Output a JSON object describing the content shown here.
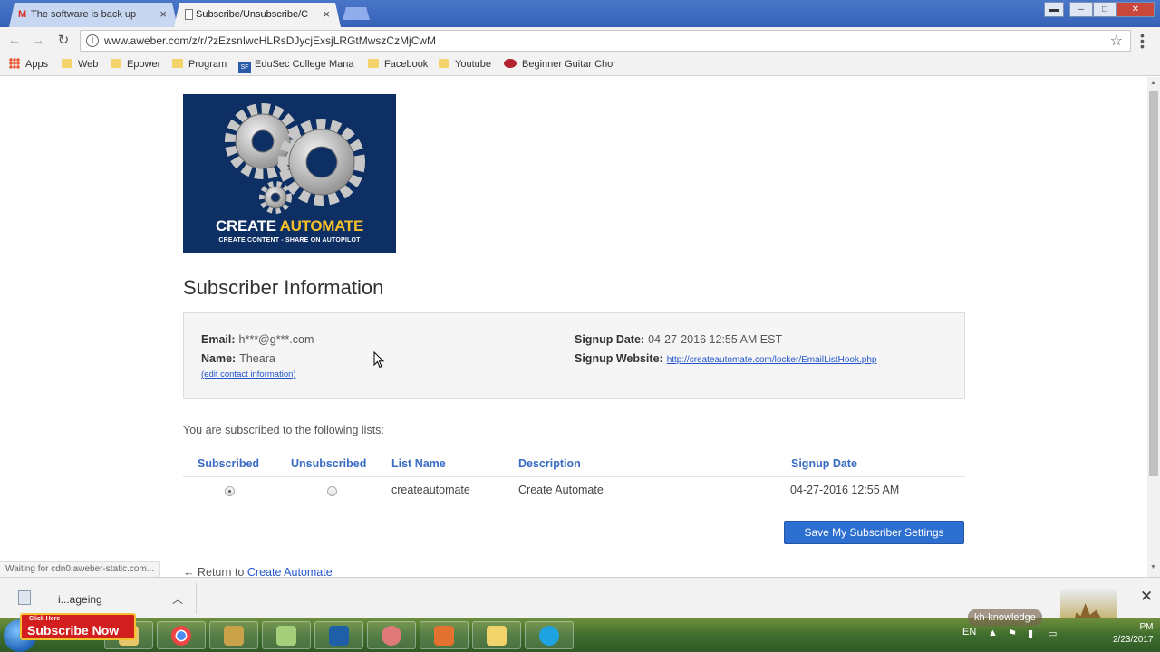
{
  "browser": {
    "tabs": [
      {
        "label": "The software is back up",
        "active": false,
        "favicon": "gmail-icon"
      },
      {
        "label": "Subscribe/Unsubscribe/C",
        "active": true,
        "favicon": "page-icon"
      }
    ],
    "url": "www.aweber.com/z/r/?zEzsnIwcHLRsDJycjExsjLRGtMwszCzMjCwM",
    "bookmarks": [
      "Apps",
      "Web",
      "Epower",
      "Program",
      "EduSec College Mana",
      "Facebook",
      "Youtube",
      "Beginner Guitar Chor"
    ],
    "status_text": "Waiting for cdn0.aweber-static.com..."
  },
  "page": {
    "logo": {
      "brand_left": "CREATE ",
      "brand_right": "AUTOMATE",
      "tagline": "CREATE CONTENT - SHARE ON AUTOPILOT"
    },
    "title": "Subscriber Information",
    "info": {
      "email_label": "Email:",
      "email": "h***@g***.com",
      "name_label": "Name:",
      "name": "Theara",
      "edit_link": "(edit contact information)",
      "signup_date_label": "Signup Date:",
      "signup_date": "04-27-2016 12:55 AM EST",
      "signup_website_label": "Signup Website:",
      "signup_website": "http://createautomate.com/locker/EmailListHook.php"
    },
    "lists_intro": "You are subscribed to the following lists:",
    "table": {
      "headers": [
        "Subscribed",
        "Unsubscribed",
        "List Name",
        "Description",
        "Signup Date"
      ],
      "rows": [
        {
          "subscribed": true,
          "list_name": "createautomate",
          "description": "Create Automate",
          "signup_date": "04-27-2016 12:55 AM"
        }
      ]
    },
    "save_button": "Save My Subscriber Settings",
    "return_prefix": "← Return to ",
    "return_link": "Create Automate"
  },
  "download_shelf": {
    "file_name": "i...ageing"
  },
  "overlay": {
    "click_here": "Click Here",
    "subscribe": "Subscribe Now",
    "channel": "kh-knowledge"
  },
  "taskbar": {
    "lang": "EN",
    "time": "PM",
    "date": "2/23/2017"
  }
}
